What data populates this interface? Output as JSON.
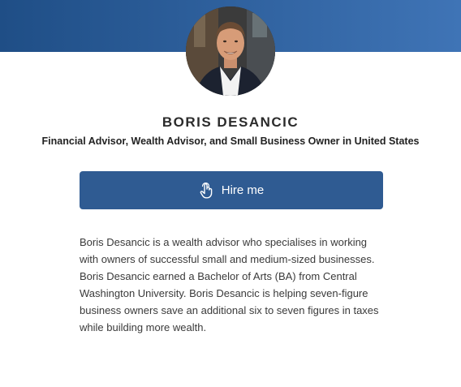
{
  "profile": {
    "name": "BORIS DESANCIC",
    "subtitle": "Financial Advisor, Wealth Advisor, and Small Business Owner in United States",
    "avatar_alt": "Boris Desancic"
  },
  "actions": {
    "hire_label": "Hire me",
    "hire_icon": "hand-pointer-icon"
  },
  "bio": {
    "text": "Boris Desancic is a wealth advisor who specialises in working with owners of successful small and medium-sized businesses. Boris Desancic earned a Bachelor of Arts (BA) from Central Washington University. Boris Desancic is helping seven-figure business owners save an additional six to seven figures in taxes while building more wealth."
  },
  "colors": {
    "banner_start": "#1f4e86",
    "banner_end": "#3f74b6",
    "button": "#2f5b92"
  }
}
